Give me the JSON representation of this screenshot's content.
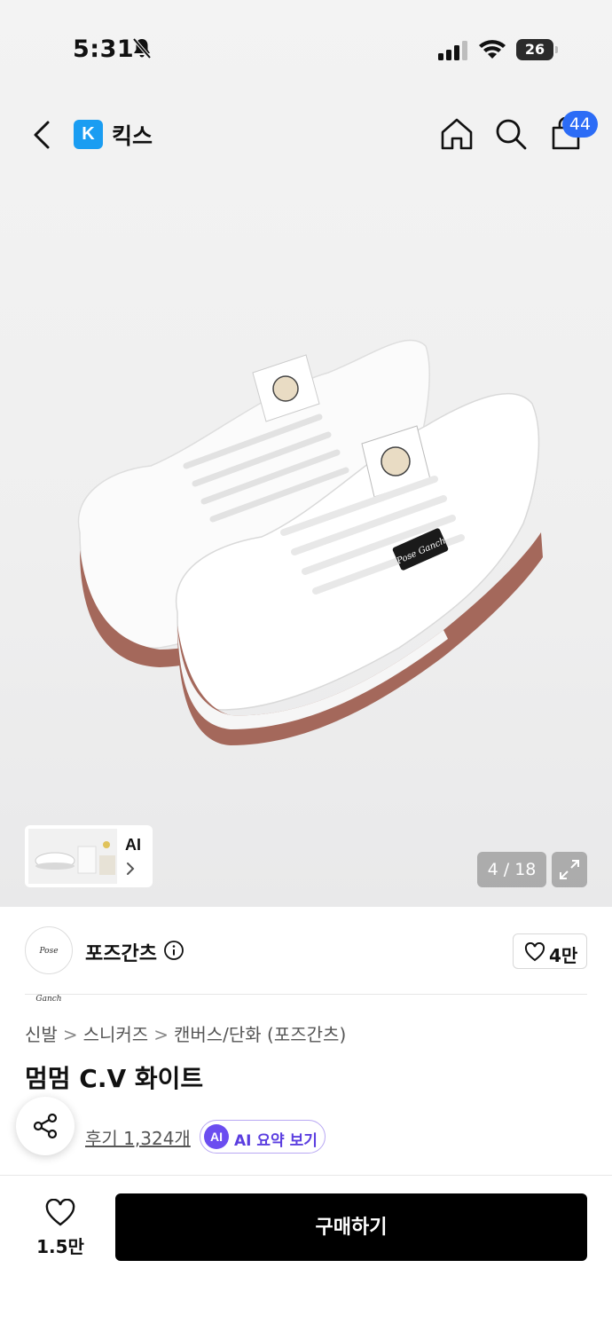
{
  "status_bar": {
    "time": "5:31",
    "battery": "26"
  },
  "nav": {
    "store_logo": "K",
    "store_name": "킥스",
    "cart_count": "44"
  },
  "gallery": {
    "counter": "4 / 18",
    "thumb_ai_label": "AI",
    "product_image_label": "Pose Ganch"
  },
  "brand": {
    "logo_text": "Pose Ganch",
    "name": "포즈간츠",
    "like_count": "4만"
  },
  "breadcrumb": [
    "신발",
    "스니커즈",
    "캔버스/단화 (포즈간츠)"
  ],
  "product": {
    "title": "멈멈 C.V 화이트"
  },
  "reviews": {
    "link_text": "후기 1,324개",
    "ai_badge": "AI",
    "ai_summary_label": "AI 요약 보기"
  },
  "bottom_bar": {
    "wish_count": "1.5만",
    "buy_label": "구매하기"
  },
  "colors": {
    "accent_blue": "#2c6cf6",
    "store_logo_blue": "#1a9df2",
    "ai_purple": "#6b4df0",
    "buy_button": "#000000"
  },
  "icons": [
    "bell-slash-icon",
    "signal-icon",
    "wifi-icon",
    "battery-icon",
    "back-chevron-icon",
    "home-icon",
    "search-icon",
    "cart-icon",
    "expand-icon",
    "info-icon",
    "heart-icon",
    "share-icon",
    "chevron-right-icon"
  ]
}
